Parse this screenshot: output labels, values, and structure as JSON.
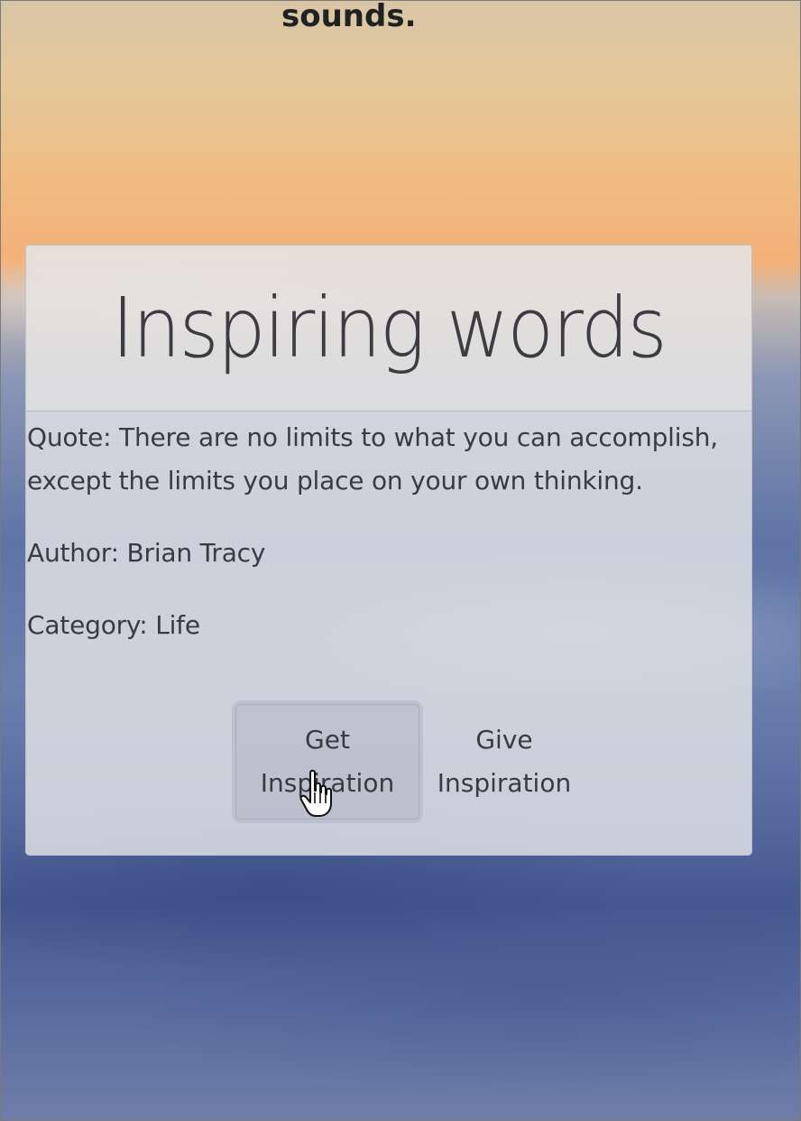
{
  "header": {
    "partial_text": "sounds."
  },
  "card": {
    "title": "Inspiring words",
    "quote": "Quote: There are no limits to what you can accomplish, except the limits you place on your own thinking.",
    "author": "Author: Brian Tracy",
    "category": "Category: Life"
  },
  "buttons": {
    "get_line1": "Get",
    "get_line2": "Inspiration",
    "give_line1": "Give",
    "give_line2": "Inspiration"
  },
  "colors": {
    "card_bg": "#dedfe4",
    "text": "#3a3a40"
  },
  "icons": {
    "cursor": "hand-pointer-icon"
  }
}
